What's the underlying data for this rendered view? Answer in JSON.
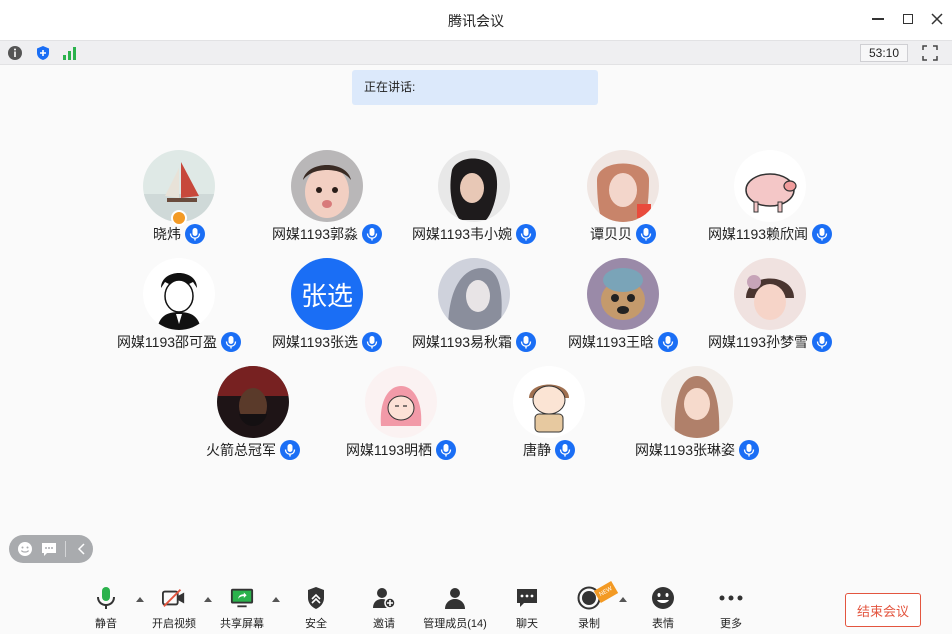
{
  "window": {
    "title": "腾讯会议"
  },
  "status": {
    "timer": "53:10"
  },
  "speaking": {
    "label": "正在讲话:"
  },
  "participants": [
    {
      "name": "晓炜",
      "avatar": "photo-sailboat",
      "host": true
    },
    {
      "name": "网媒1193郭淼",
      "avatar": "photo-child"
    },
    {
      "name": "网媒1193韦小婉",
      "avatar": "photo-woman"
    },
    {
      "name": "谭贝贝",
      "avatar": "photo-girl"
    },
    {
      "name": "网媒1193赖欣闻",
      "avatar": "drawing-pig"
    },
    {
      "name": "网媒1193邵可盈",
      "avatar": "drawing-boy"
    },
    {
      "name": "网媒1193张选",
      "avatar_text": "张选"
    },
    {
      "name": "网媒1193易秋霜",
      "avatar": "drawing-girl"
    },
    {
      "name": "网媒1193王晗",
      "avatar": "photo-dog"
    },
    {
      "name": "网媒1193孙梦雪",
      "avatar": "photo-kid"
    },
    {
      "name": "火箭总冠军",
      "avatar": "photo-player"
    },
    {
      "name": "网媒1193明栖",
      "avatar": "drawing-pink"
    },
    {
      "name": "唐静",
      "avatar": "drawing-cartoon"
    },
    {
      "name": "网媒1193张琳姿",
      "avatar": "photo-lady"
    }
  ],
  "toolbar": {
    "mute": "静音",
    "video": "开启视频",
    "share": "共享屏幕",
    "security": "安全",
    "invite": "邀请",
    "members": "管理成员(14)",
    "chat": "聊天",
    "record": "录制",
    "reactions": "表情",
    "more": "更多",
    "end": "结束会议",
    "new_tag": "NEW"
  },
  "colors": {
    "accent": "#1a6ef5",
    "danger": "#e3553f",
    "host": "#f39a24"
  }
}
